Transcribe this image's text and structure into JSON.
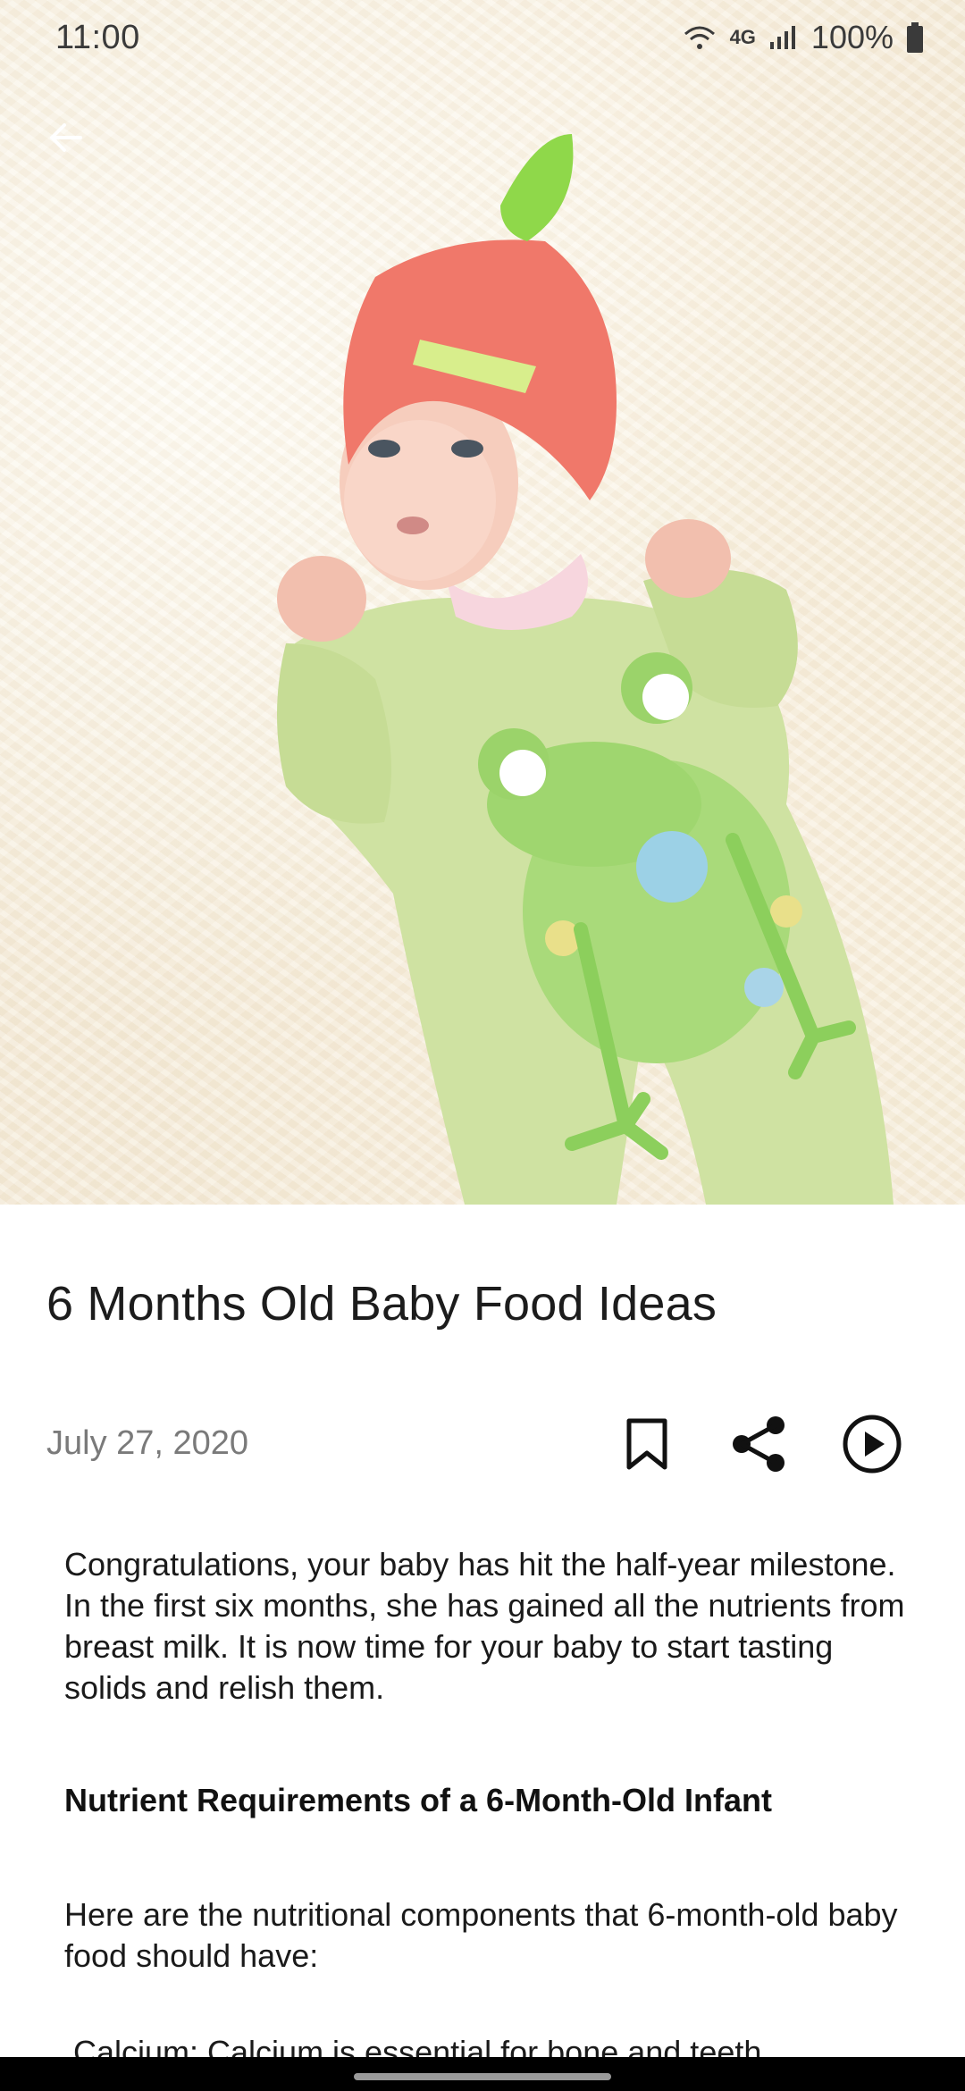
{
  "status_bar": {
    "time": "11:00",
    "network": "4G",
    "battery": "100%"
  },
  "article": {
    "title": "6 Months Old Baby Food Ideas",
    "date": "July 27, 2020",
    "intro": "Congratulations, your baby has hit the half-year milestone. In the first six months, she has gained all the nutrients from breast milk. It is now time for your baby to start tasting solids and relish them.",
    "section_heading": "Nutrient Requirements of a 6-Month-Old Infant",
    "section_intro": "Here are the nutritional components that 6-month-old baby food should have:",
    "list_first_item": "Calcium: Calcium is essential for bone and teeth"
  },
  "icons": {
    "back": "arrow-back-icon",
    "bookmark": "bookmark-icon",
    "share": "share-icon",
    "play": "play-circle-icon",
    "wifi": "wifi-icon",
    "signal": "signal-icon",
    "battery": "battery-icon"
  },
  "colors": {
    "accent_text": "#1c1c1c",
    "muted_text": "#7a7a7a",
    "hat": "#f0786a",
    "onesie": "#cfe2a2"
  }
}
